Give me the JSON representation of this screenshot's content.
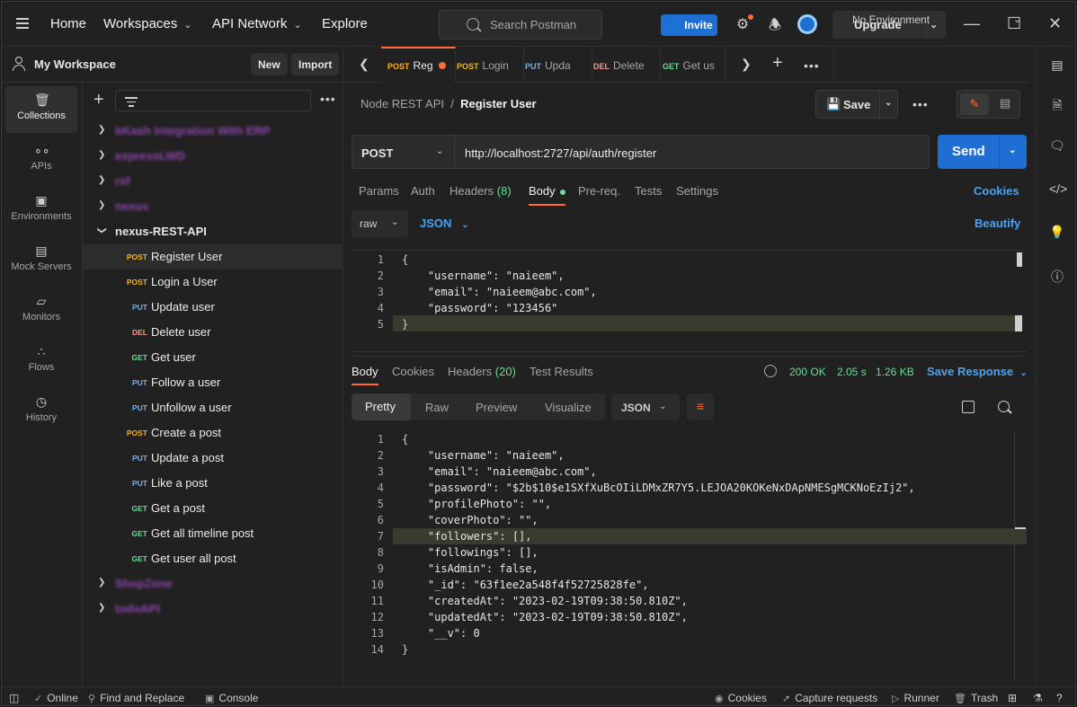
{
  "topbar": {
    "home": "Home",
    "workspaces": "Workspaces",
    "api_network": "API Network",
    "explore": "Explore",
    "search_placeholder": "Search Postman",
    "invite": "Invite",
    "upgrade": "Upgrade"
  },
  "workspace": {
    "title": "My Workspace",
    "new": "New",
    "import": "Import"
  },
  "rail": [
    {
      "label": "Collections",
      "icon": "collections-icon",
      "active": true
    },
    {
      "label": "APIs",
      "icon": "apis-icon"
    },
    {
      "label": "Environments",
      "icon": "environments-icon"
    },
    {
      "label": "Mock Servers",
      "icon": "mock-servers-icon"
    },
    {
      "label": "Monitors",
      "icon": "monitors-icon"
    },
    {
      "label": "Flows",
      "icon": "flows-icon"
    },
    {
      "label": "History",
      "icon": "history-icon"
    }
  ],
  "collections": {
    "blurred": [
      "bKash Integration With ERP",
      "expressLWD",
      "rsf",
      "nexus",
      "ShopZone",
      "todoAPI"
    ],
    "open": "nexus-REST-API",
    "requests": [
      {
        "method": "POST",
        "name": "Register User"
      },
      {
        "method": "POST",
        "name": "Login a User"
      },
      {
        "method": "PUT",
        "name": "Update user"
      },
      {
        "method": "DEL",
        "name": "Delete user"
      },
      {
        "method": "GET",
        "name": "Get user"
      },
      {
        "method": "PUT",
        "name": "Follow a user"
      },
      {
        "method": "PUT",
        "name": "Unfollow a user"
      },
      {
        "method": "POST",
        "name": "Create a post"
      },
      {
        "method": "PUT",
        "name": "Update a post"
      },
      {
        "method": "PUT",
        "name": "Like a post"
      },
      {
        "method": "GET",
        "name": "Get a post"
      },
      {
        "method": "GET",
        "name": "Get all timeline post"
      },
      {
        "method": "GET",
        "name": "Get user all post"
      }
    ]
  },
  "tabs": [
    {
      "method": "POST",
      "title": "Reg"
    },
    {
      "method": "POST",
      "title": "Login"
    },
    {
      "method": "PUT",
      "title": "Upda"
    },
    {
      "method": "DEL",
      "title": "Delete"
    },
    {
      "method": "GET",
      "title": "Get us"
    }
  ],
  "environment": "No Environment",
  "request": {
    "breadcrumb_parent": "Node REST API",
    "breadcrumb_sep": "/",
    "breadcrumb_current": "Register User",
    "save": "Save",
    "method": "POST",
    "url": "http://localhost:2727/api/auth/register",
    "send": "Send",
    "tabs": {
      "params": "Params",
      "auth": "Auth",
      "headers": "Headers",
      "headers_count": "(8)",
      "body": "Body",
      "prereq": "Pre-req.",
      "tests": "Tests",
      "settings": "Settings"
    },
    "cookies": "Cookies",
    "body_mode": "raw",
    "body_lang": "JSON",
    "beautify": "Beautify",
    "body_lines": [
      "{",
      "    \"username\": \"naieem\",",
      "    \"email\": \"naieem@abc.com\",",
      "    \"password\": \"123456\"",
      "}"
    ]
  },
  "response": {
    "tabs": {
      "body": "Body",
      "cookies": "Cookies",
      "headers": "Headers",
      "headers_count": "(20)",
      "tests": "Test Results"
    },
    "status": "200 OK",
    "time": "2.05 s",
    "size": "1.26 KB",
    "save": "Save Response",
    "views": [
      "Pretty",
      "Raw",
      "Preview",
      "Visualize"
    ],
    "lang": "JSON",
    "lines": [
      "{",
      "    \"username\": \"naieem\",",
      "    \"email\": \"naieem@abc.com\",",
      "    \"password\": \"$2b$10$e1SXfXuBcOIiLDMxZR7Y5.LEJOA20KOKeNxDApNMESgMCKNoEzIj2\",",
      "    \"profilePhoto\": \"\",",
      "    \"coverPhoto\": \"\",",
      "    \"followers\": [],",
      "    \"followings\": [],",
      "    \"isAdmin\": false,",
      "    \"_id\": \"63f1ee2a548f4f52725828fe\",",
      "    \"createdAt\": \"2023-02-19T09:38:50.810Z\",",
      "    \"updatedAt\": \"2023-02-19T09:38:50.810Z\",",
      "    \"__v\": 0",
      "}"
    ]
  },
  "statusbar": {
    "online": "Online",
    "find": "Find and Replace",
    "console": "Console",
    "cookies": "Cookies",
    "capture": "Capture requests",
    "runner": "Runner",
    "trash": "Trash"
  }
}
